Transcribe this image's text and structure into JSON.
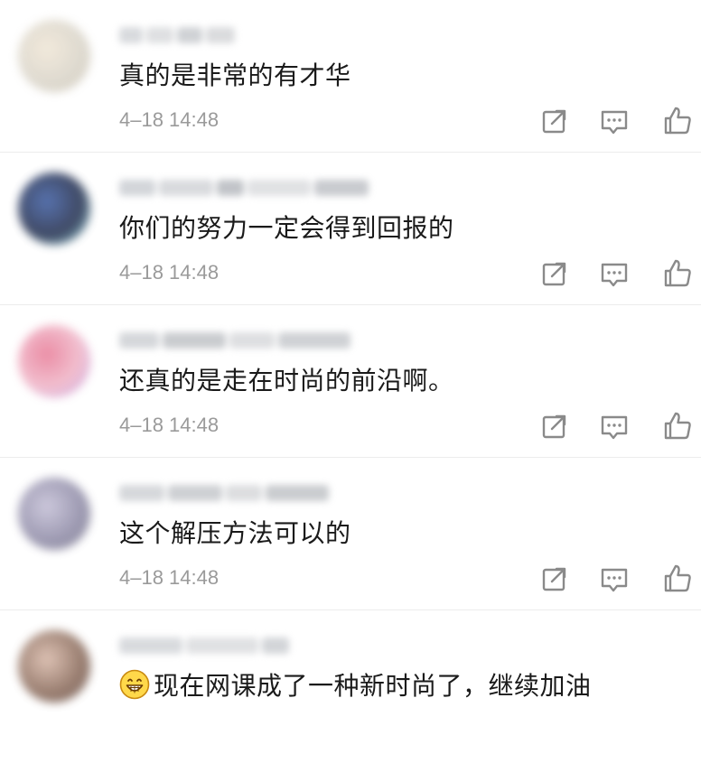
{
  "comments": [
    {
      "text": "真的是非常的有才华",
      "time": "4–18 14:48",
      "avatar_colors": [
        "#d9d4c8",
        "#f0e6d6",
        "#c8c0b0"
      ],
      "name_blur_colors": [
        "#b8bcc2",
        "#c4c6ca",
        "#a9adb3",
        "#bcbec2"
      ]
    },
    {
      "text": "你们的努力一定会得到回报的",
      "time": "4–18 14:48",
      "avatar_colors": [
        "#1f2a4a",
        "#3a5aa0",
        "#7fd0d8"
      ],
      "name_blur_colors": [
        "#aeb3bb",
        "#b9bcc2",
        "#8f949c",
        "#c7c9cd",
        "#9ca0a8"
      ]
    },
    {
      "text": "还真的是走在时尚的前沿啊。",
      "time": "4–18 14:48",
      "avatar_colors": [
        "#f0b6c8",
        "#e87a96",
        "#b48ee0"
      ],
      "name_blur_colors": [
        "#b2b6bc",
        "#9ea2a8",
        "#c2c4c8",
        "#a8acb2"
      ]
    },
    {
      "text": "这个解压方法可以的",
      "time": "4–18 14:48",
      "avatar_colors": [
        "#8e8aa6",
        "#c4bfd6",
        "#6b6a80"
      ],
      "name_blur_colors": [
        "#b4b8be",
        "#a6aab0",
        "#c0c2c6",
        "#9fa3a9"
      ]
    },
    {
      "text": "现在网课成了一种新时尚了，继续加油",
      "time": "",
      "has_emoji": true,
      "emoji": "grinning-face-emoji",
      "avatar_colors": [
        "#8a6a5a",
        "#d8b8a8",
        "#5a4038"
      ],
      "name_blur_colors": [
        "#b8bcc2",
        "#c6c8cc",
        "#aeb2b8"
      ]
    }
  ],
  "icons": {
    "share": "share-icon",
    "reply": "reply-icon",
    "like": "like-icon"
  },
  "colors": {
    "text": "#1a1a1a",
    "time": "#9a9a9a",
    "icon": "#8a8a8a",
    "divider": "#ececec"
  }
}
